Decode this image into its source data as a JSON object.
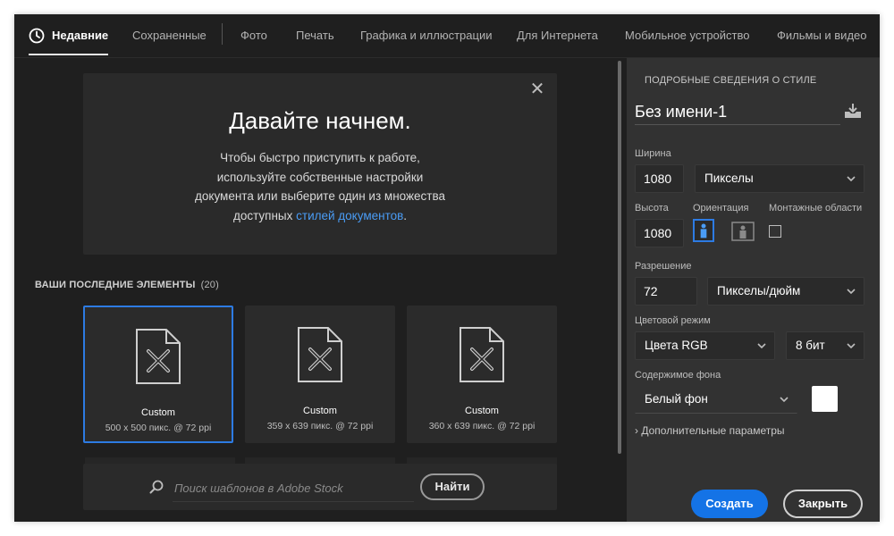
{
  "tabs": [
    {
      "label": "Недавние",
      "active": true
    },
    {
      "label": "Сохраненные"
    },
    {
      "label": "Фото"
    },
    {
      "label": "Печать"
    },
    {
      "label": "Графика и иллюстрации"
    },
    {
      "label": "Для Интернета"
    },
    {
      "label": "Мобильное устройство"
    },
    {
      "label": "Фильмы и видео"
    }
  ],
  "welcome": {
    "title": "Давайте начнем.",
    "line1": "Чтобы быстро приступить к работе,",
    "line2": "используйте собственные настройки",
    "line3": "документа или выберите один из множества",
    "line4_pre": "доступных ",
    "link": "стилей документов",
    "line4_post": ".",
    "close": "✕"
  },
  "recent": {
    "header": "ВАШИ ПОСЛЕДНИЕ ЭЛЕМЕНТЫ",
    "count": "(20)",
    "items": [
      {
        "title": "Custom",
        "sub": "500 x 500 пикс. @ 72 ppi"
      },
      {
        "title": "Custom",
        "sub": "359 x 639 пикс. @ 72 ppi"
      },
      {
        "title": "Custom",
        "sub": "360 x 639 пикс. @ 72 ppi"
      }
    ]
  },
  "search": {
    "placeholder": "Поиск шаблонов в Adobe Stock",
    "button": "Найти"
  },
  "panel": {
    "heading": "ПОДРОБНЫЕ СВЕДЕНИЯ О СТИЛЕ",
    "name": "Без имени-1",
    "width_label": "Ширина",
    "width_value": "1080",
    "width_unit": "Пикселы",
    "height_label": "Высота",
    "height_value": "1080",
    "orientation_label": "Ориентация",
    "artboards_label": "Монтажные области",
    "resolution_label": "Разрешение",
    "resolution_value": "72",
    "resolution_unit": "Пикселы/дюйм",
    "color_mode_label": "Цветовой режим",
    "color_mode": "Цвета RGB",
    "bit_depth": "8 бит",
    "background_label": "Содержимое фона",
    "background": "Белый фон",
    "background_color": "#ffffff",
    "advanced": "Дополнительные параметры",
    "create": "Создать",
    "close": "Закрыть"
  },
  "colors": {
    "accent": "#1473e6",
    "link": "#4a9cf5",
    "selected_border": "#2d7be3"
  }
}
